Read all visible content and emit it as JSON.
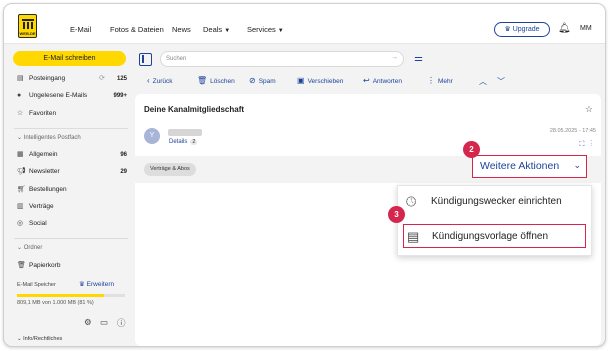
{
  "brand": {
    "logo_text": "WEB.DE"
  },
  "nav": {
    "links": [
      "E-Mail",
      "Fotos & Dateien",
      "News",
      "Deals",
      "Services"
    ],
    "upgrade_label": "Upgrade",
    "user_initials": "MM"
  },
  "sidebar": {
    "compose_label": "E-Mail schreiben",
    "inbox": {
      "label": "Posteingang",
      "count": "125"
    },
    "unread": {
      "label": "Ungelesene E-Mails",
      "count": "999+"
    },
    "favorites_label": "Favoriten",
    "smart_header": "Intelligentes Postfach",
    "smart_items": [
      {
        "label": "Allgemein",
        "count": "96"
      },
      {
        "label": "Newsletter",
        "count": "29"
      },
      {
        "label": "Bestellungen",
        "count": ""
      },
      {
        "label": "Verträge",
        "count": ""
      },
      {
        "label": "Social",
        "count": ""
      }
    ],
    "folders_header": "Ordner",
    "trash_label": "Papierkorb",
    "storage_label": "E-Mail Speicher",
    "expand_label": "Erweitern",
    "storage_used_fraction": 0.81,
    "storage_text": "809,1 MB von 1.000 MB (81 %)",
    "info_label": "Info/Rechtliches"
  },
  "search": {
    "placeholder": "Suchen"
  },
  "toolbar": {
    "back": "Zurück",
    "delete": "Löschen",
    "spam": "Spam",
    "move": "Verschieben",
    "reply": "Antworten",
    "more": "Mehr"
  },
  "message": {
    "subject": "Deine Kanalmitgliedschaft",
    "avatar_initial": "Y",
    "details_label": "Details",
    "details_count": "2",
    "date": "28.05.2025 - 17:45",
    "tag": "Verträge & Abos"
  },
  "more_actions": {
    "label": "Weitere Aktionen"
  },
  "menu": {
    "items": [
      "Kündigungswecker einrichten",
      "Kündigungsvorlage öffnen"
    ]
  },
  "steps": [
    "2",
    "3"
  ],
  "colors": {
    "accent_yellow": "#ffd800",
    "brand_blue": "#1c449b",
    "highlight_red": "#d5264e"
  }
}
